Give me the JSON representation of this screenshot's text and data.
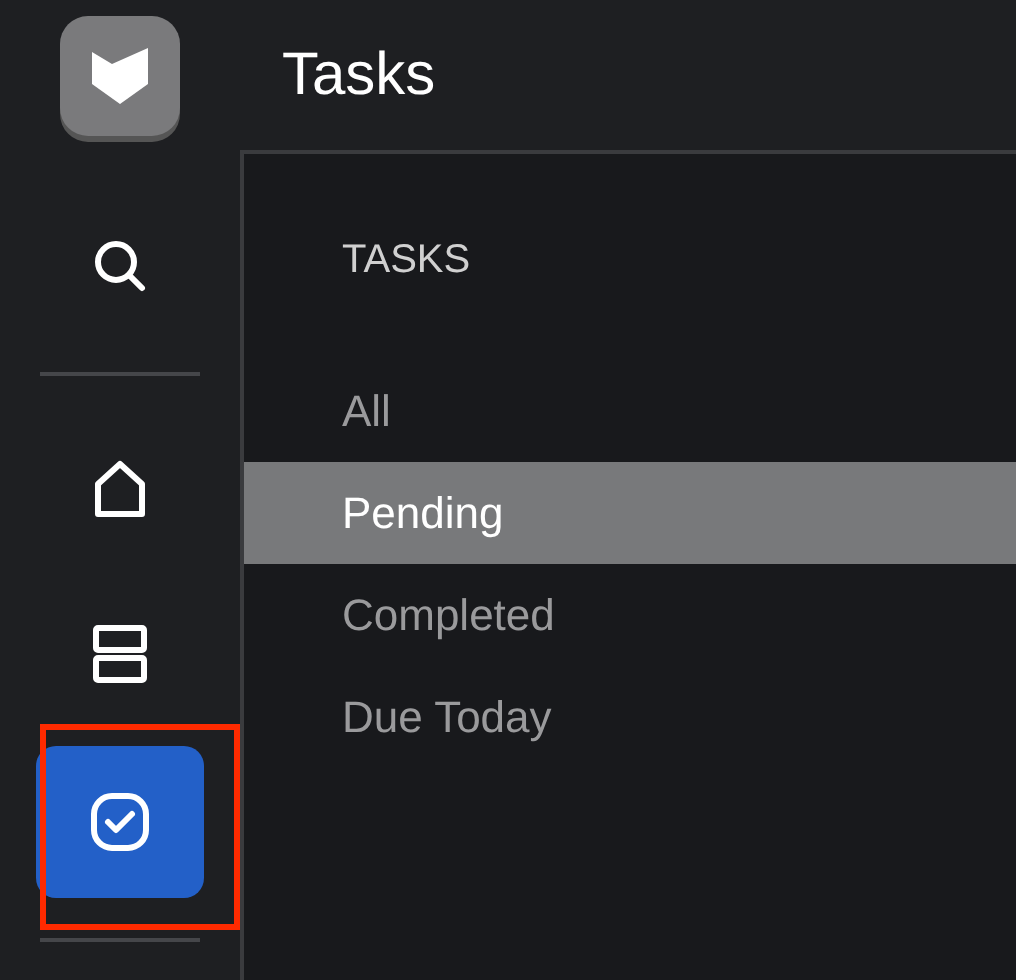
{
  "header": {
    "title": "Tasks"
  },
  "rail": {
    "items": [
      {
        "kind": "search",
        "selected": false,
        "highlighted": false
      },
      {
        "kind": "home",
        "selected": false,
        "highlighted": false
      },
      {
        "kind": "layers",
        "selected": false,
        "highlighted": false
      },
      {
        "kind": "tasks",
        "selected": true,
        "highlighted": true
      }
    ]
  },
  "panel": {
    "heading": "TASKS",
    "items": [
      {
        "label": "All",
        "selected": false
      },
      {
        "label": "Pending",
        "selected": true
      },
      {
        "label": "Completed",
        "selected": false
      },
      {
        "label": "Due Today",
        "selected": false
      }
    ]
  }
}
